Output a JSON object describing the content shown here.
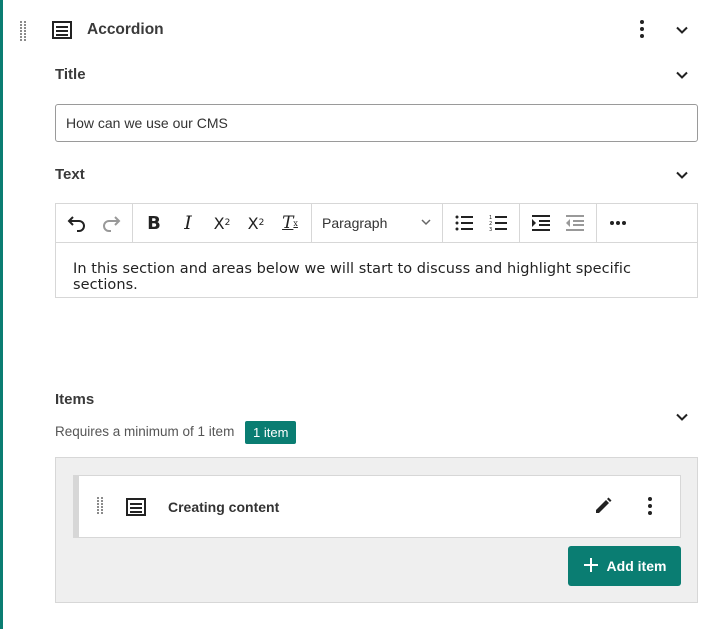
{
  "block": {
    "title": "Accordion",
    "icon": "accordion-icon"
  },
  "title_field": {
    "label": "Title",
    "value": "How can we use our CMS"
  },
  "text_field": {
    "label": "Text",
    "paragraph_style": "Paragraph",
    "body": "In this section and areas below we will start to discuss and highlight specific sections."
  },
  "toolbar": {
    "icons": [
      "undo-icon",
      "redo-icon",
      "bold-icon",
      "italic-icon",
      "subscript-icon",
      "superscript-icon",
      "clear-format-icon",
      "chevron-down-icon",
      "bulleted-list-icon",
      "numbered-list-icon",
      "indent-icon",
      "outdent-icon",
      "more-icon"
    ]
  },
  "items": {
    "label": "Items",
    "requirement": "Requires a minimum of 1 item",
    "count_badge": "1 item",
    "list": [
      {
        "title": "Creating content"
      }
    ],
    "add_label": "Add item"
  },
  "colors": {
    "accent": "#0a7d72",
    "panel_bg": "#efefef",
    "border": "#d7d7d7"
  }
}
